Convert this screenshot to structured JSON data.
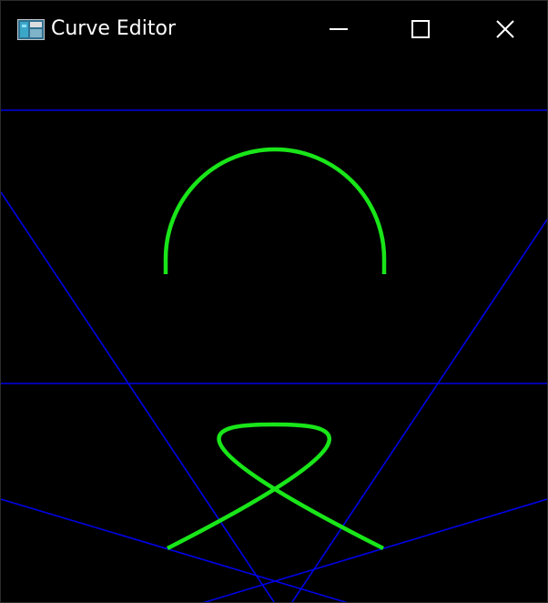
{
  "window": {
    "title": "Curve Editor",
    "icon": "app-window-icon",
    "controls": {
      "minimize_icon": "minimize-icon",
      "maximize_icon": "maximize-icon",
      "close_icon": "close-icon"
    }
  },
  "canvas": {
    "background": "#000000",
    "construction_line_color": "#0000e6",
    "curve_color": "#19e619",
    "curves": [
      {
        "name": "arc-curve",
        "shape": "semicircle"
      },
      {
        "name": "loop-curve",
        "shape": "bezier-loop"
      }
    ]
  }
}
